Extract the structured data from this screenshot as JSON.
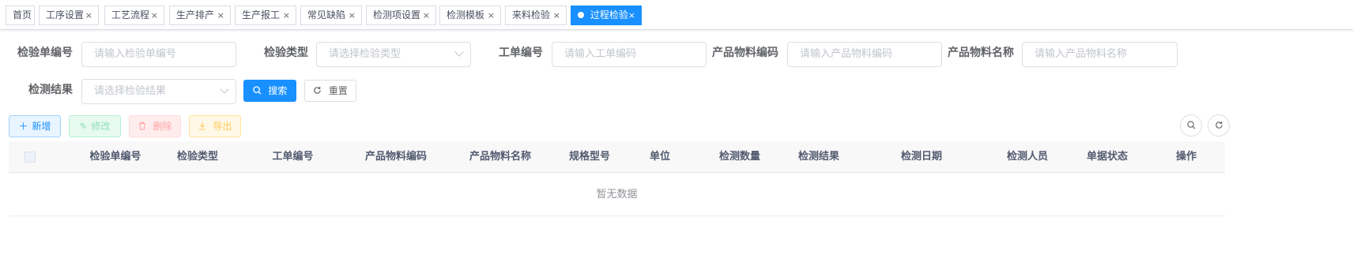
{
  "tags": [
    {
      "label": "首页",
      "closable": false,
      "active": false
    },
    {
      "label": "工序设置",
      "closable": true,
      "active": false
    },
    {
      "label": "工艺流程",
      "closable": true,
      "active": false
    },
    {
      "label": "生产排产",
      "closable": true,
      "active": false
    },
    {
      "label": "生产报工",
      "closable": true,
      "active": false
    },
    {
      "label": "常见缺陷",
      "closable": true,
      "active": false
    },
    {
      "label": "检测项设置",
      "closable": true,
      "active": false
    },
    {
      "label": "检测模板",
      "closable": true,
      "active": false
    },
    {
      "label": "来料检验",
      "closable": true,
      "active": false
    },
    {
      "label": "过程检验",
      "closable": true,
      "active": true
    }
  ],
  "tag_close_glyph": "×",
  "form": {
    "inspection_no": {
      "label": "检验单编号",
      "placeholder": "请输入检验单编号"
    },
    "inspection_type": {
      "label": "检验类型",
      "placeholder": "请选择检验类型"
    },
    "work_order_no": {
      "label": "工单编号",
      "placeholder": "请输入工单编码"
    },
    "material_code": {
      "label": "产品物料编码",
      "placeholder": "请输入产品物料编码"
    },
    "material_name": {
      "label": "产品物料名称",
      "placeholder": "请输入产品物料名称"
    },
    "result": {
      "label": "检测结果",
      "placeholder": "请选择检验结果"
    },
    "search_label": "搜索",
    "reset_label": "重置"
  },
  "toolbar": {
    "add_label": "新增",
    "edit_label": "修改",
    "delete_label": "删除",
    "export_label": "导出"
  },
  "icons": {
    "search": "search-icon",
    "refresh": "refresh-icon",
    "add": "plus-icon",
    "edit": "edit-icon",
    "delete": "trash-icon",
    "export": "download-icon"
  },
  "table": {
    "columns": [
      "检验单编号",
      "检验类型",
      "工单编号",
      "产品物料编码",
      "产品物料名称",
      "规格型号",
      "单位",
      "检测数量",
      "检测结果",
      "检测日期",
      "检测人员",
      "单据状态",
      "操作"
    ],
    "empty_text": "暂无数据"
  },
  "colors": {
    "primary": "#1890ff",
    "success": "#13ce66",
    "danger": "#ff4949",
    "warning": "#ffba00"
  }
}
